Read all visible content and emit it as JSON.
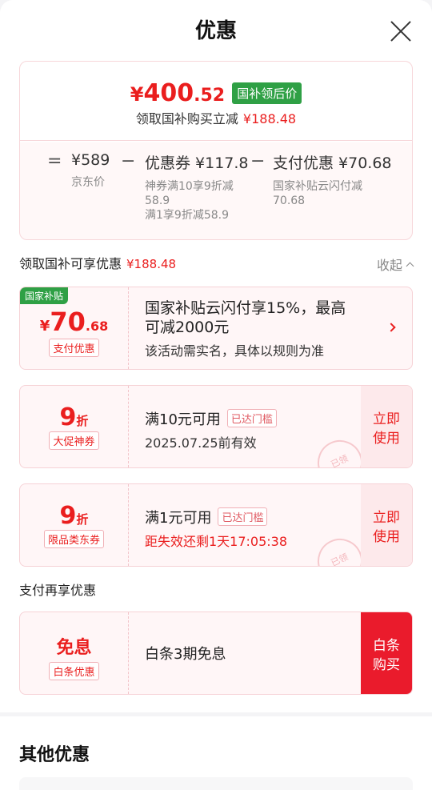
{
  "header": {
    "title": "优惠"
  },
  "summary": {
    "price_symbol": "¥",
    "price_int": "400",
    "price_dec": ".52",
    "price_tag": "国补领后价",
    "sub_text": "领取国补购买立减",
    "sub_amount": "¥188.48",
    "formula": {
      "eq": "=",
      "jd_price": "¥589",
      "jd_label": "京东价",
      "minus1": "−",
      "coupon": "优惠券 ¥117.8",
      "coupon_line1": "神券满10享9折减",
      "coupon_line2": "58.9",
      "coupon_line3": "满1享9折减58.9",
      "minus2": "−",
      "pay": "支付优惠 ¥70.68",
      "pay_line1": "国家补贴云闪付减",
      "pay_line2": "70.68"
    }
  },
  "section1": {
    "label": "领取国补可享优惠",
    "amount": "¥188.48",
    "collapse": "收起"
  },
  "card_subsidy": {
    "corner": "国家补贴",
    "sym": "¥",
    "amount_int": "70",
    "amount_dec": ".68",
    "pill": "支付优惠",
    "line1a": "国家补贴云闪付享15%，最高",
    "line1b": "可减2000元",
    "line2": "该活动需实名，具体以规则为准"
  },
  "card_coupon1": {
    "big": "9",
    "unit": "折",
    "pill": "大促神券",
    "line1": "满10元可用",
    "reached": "已达门槛",
    "line2": "2025.07.25前有效",
    "use_a": "立即",
    "use_b": "使用",
    "stamp": "已领"
  },
  "card_coupon2": {
    "big": "9",
    "unit": "折",
    "pill": "限品类东券",
    "line1": "满1元可用",
    "reached": "已达门槛",
    "line2": "距失效还剩1天17:05:38",
    "use_a": "立即",
    "use_b": "使用",
    "stamp": "已领"
  },
  "section2": {
    "label": "支付再享优惠"
  },
  "card_baitiao": {
    "big": "免息",
    "pill": "白条优惠",
    "line1": "白条3期免息",
    "btn_a": "白条",
    "btn_b": "购买"
  },
  "other": {
    "title": "其他优惠"
  },
  "colors": {
    "accent_red": "#ea1e1e",
    "tag_green": "#2fa045",
    "card_bg": "#fff6f7"
  }
}
